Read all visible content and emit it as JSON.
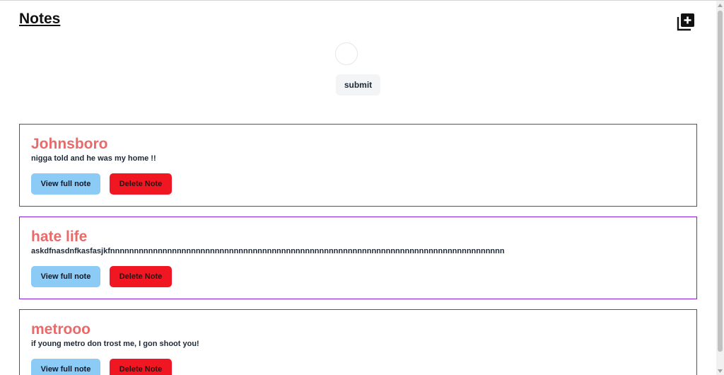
{
  "header": {
    "title": "Notes"
  },
  "form": {
    "submit_label": "submit"
  },
  "notes": [
    {
      "title": "Johnsboro",
      "body": "nigga told and he was my home !!",
      "view_label": "View full note",
      "delete_label": "Delete Note"
    },
    {
      "title": "hate life",
      "body": "askdfnasdnfkasfasjkfnnnnnnnnnnnnnnnnnnnnnnnnnnnnnnnnnnnnnnnnnnnnnnnnnnnnnnnnnnnnnnnnnnnnnnnnnnnnnnnnnnn",
      "view_label": "View full note",
      "delete_label": "Delete Note"
    },
    {
      "title": "metrooo",
      "body": "if young metro don trost me, I gon shoot you!",
      "view_label": "View full note",
      "delete_label": "Delete Note"
    }
  ],
  "icons": {
    "add": "add-note-icon"
  },
  "colors": {
    "note_border": "#8b1fd6",
    "note_title": "#e86a6a",
    "view_button": "#8ccbf5",
    "delete_button": "#f01622"
  }
}
